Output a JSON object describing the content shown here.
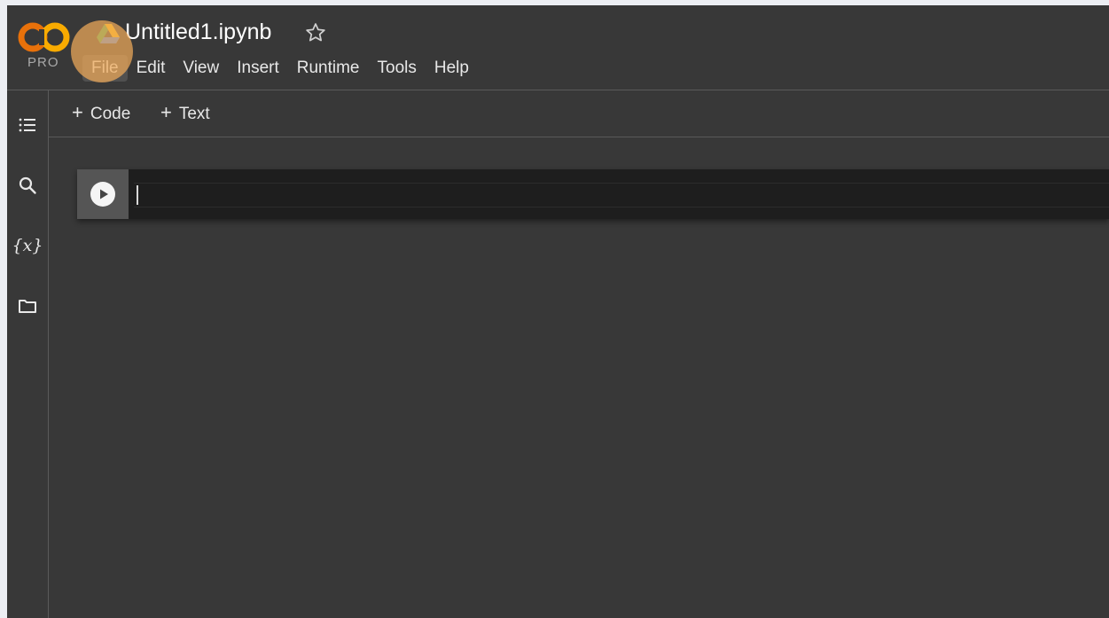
{
  "logo": {
    "pro_label": "PRO"
  },
  "notebook": {
    "title": "Untitled1.ipynb"
  },
  "menu": {
    "items": [
      "File",
      "Edit",
      "View",
      "Insert",
      "Runtime",
      "Tools",
      "Help"
    ]
  },
  "toolbar": {
    "add_code_label": "Code",
    "add_text_label": "Text",
    "plus": "+"
  },
  "rail": {
    "variables_label": "{x}"
  },
  "icons": {
    "logo": "colab-logo-icon",
    "drive": "google-drive-icon",
    "star": "star-outline-icon",
    "toc": "table-of-contents-icon",
    "search": "search-icon",
    "files": "folder-icon",
    "run": "play-circle-icon"
  },
  "colors": {
    "background": "#383838",
    "logo_orange": "#f9ab00",
    "logo_orange_dark": "#e8710a",
    "cell_background": "#1e1e1e",
    "highlight": "#f0aa5a"
  }
}
